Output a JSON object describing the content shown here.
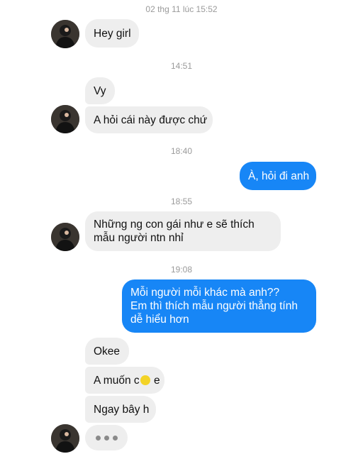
{
  "header_timestamp": "02 thg 11 lúc 15:52",
  "timestamps": {
    "t1": "14:51",
    "t2": "18:40",
    "t3": "18:55",
    "t4": "19:08"
  },
  "messages": {
    "m1": "Hey girl",
    "m2": "Vy",
    "m3": "A hỏi cái này được chứ",
    "m4": "À, hỏi đi anh",
    "m5_line1": "Những ng con gái như e sẽ thích",
    "m5_line2": "mẫu người ntn nhỉ",
    "m6_line1": "Mỗi người mỗi khác mà anh??",
    "m6_line2": "Em thì thích mẫu người thẳng tính",
    "m6_line3": "dễ hiểu hơn",
    "m7": "Okee",
    "m8_a": "A muốn c",
    "m8_b": "e",
    "m9": "Ngay bây h"
  },
  "icons": {
    "avatar": "profile-photo",
    "typing": "typing-indicator-dots",
    "sticker": "yellow-emoji-sticker"
  },
  "colors": {
    "outgoing_bubble": "#1786f6",
    "incoming_bubble": "#eeeeee",
    "timestamp_text": "#9a9a9a"
  }
}
